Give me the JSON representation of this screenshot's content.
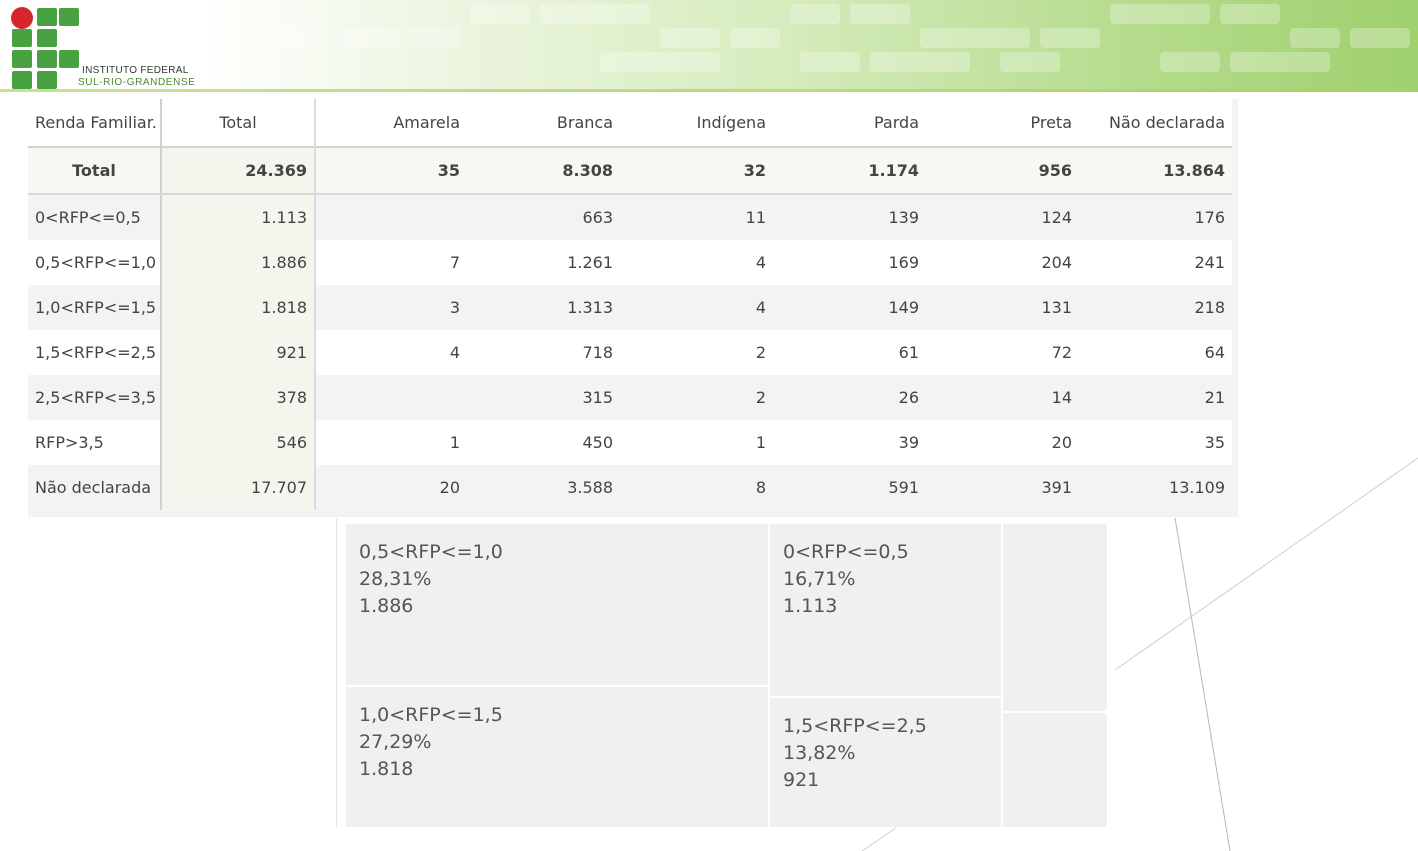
{
  "header": {
    "institution": "INSTITUTO FEDERAL",
    "institution_sub": "SUL-RIO-GRANDENSE",
    "colors": {
      "logo_green": "#48a23f",
      "logo_red": "#d7262b",
      "band": "#9fd06e"
    }
  },
  "table": {
    "columns": [
      "Renda Familiar.",
      "Total",
      "Amarela",
      "Branca",
      "Indígena",
      "Parda",
      "Preta",
      "Não declarada"
    ],
    "rows": [
      {
        "label": "Total",
        "total": "24.369",
        "amarela": "35",
        "branca": "8.308",
        "indigena": "32",
        "parda": "1.174",
        "preta": "956",
        "nao_declarada": "13.864"
      },
      {
        "label": "0<RFP<=0,5",
        "total": "1.113",
        "amarela": "",
        "branca": "663",
        "indigena": "11",
        "parda": "139",
        "preta": "124",
        "nao_declarada": "176"
      },
      {
        "label": "0,5<RFP<=1,0",
        "total": "1.886",
        "amarela": "7",
        "branca": "1.261",
        "indigena": "4",
        "parda": "169",
        "preta": "204",
        "nao_declarada": "241"
      },
      {
        "label": "1,0<RFP<=1,5",
        "total": "1.818",
        "amarela": "3",
        "branca": "1.313",
        "indigena": "4",
        "parda": "149",
        "preta": "131",
        "nao_declarada": "218"
      },
      {
        "label": "1,5<RFP<=2,5",
        "total": "921",
        "amarela": "4",
        "branca": "718",
        "indigena": "2",
        "parda": "61",
        "preta": "72",
        "nao_declarada": "64"
      },
      {
        "label": "2,5<RFP<=3,5",
        "total": "378",
        "amarela": "",
        "branca": "315",
        "indigena": "2",
        "parda": "26",
        "preta": "14",
        "nao_declarada": "21"
      },
      {
        "label": "RFP>3,5",
        "total": "546",
        "amarela": "1",
        "branca": "450",
        "indigena": "1",
        "parda": "39",
        "preta": "20",
        "nao_declarada": "35"
      },
      {
        "label": "Não declarada",
        "total": "17.707",
        "amarela": "20",
        "branca": "3.588",
        "indigena": "8",
        "parda": "591",
        "preta": "391",
        "nao_declarada": "13.109"
      }
    ]
  },
  "treemap": {
    "tiles": [
      {
        "label": "0,5<RFP<=1,0",
        "percent": "28,31%",
        "value": "1.886"
      },
      {
        "label": "0<RFP<=0,5",
        "percent": "16,71%",
        "value": "1.113"
      },
      {
        "label": "1,0<RFP<=1,5",
        "percent": "27,29%",
        "value": "1.818"
      },
      {
        "label": "1,5<RFP<=2,5",
        "percent": "13,82%",
        "value": "921"
      },
      {
        "label": "",
        "percent": "",
        "value": ""
      },
      {
        "label": "",
        "percent": "",
        "value": ""
      }
    ]
  }
}
